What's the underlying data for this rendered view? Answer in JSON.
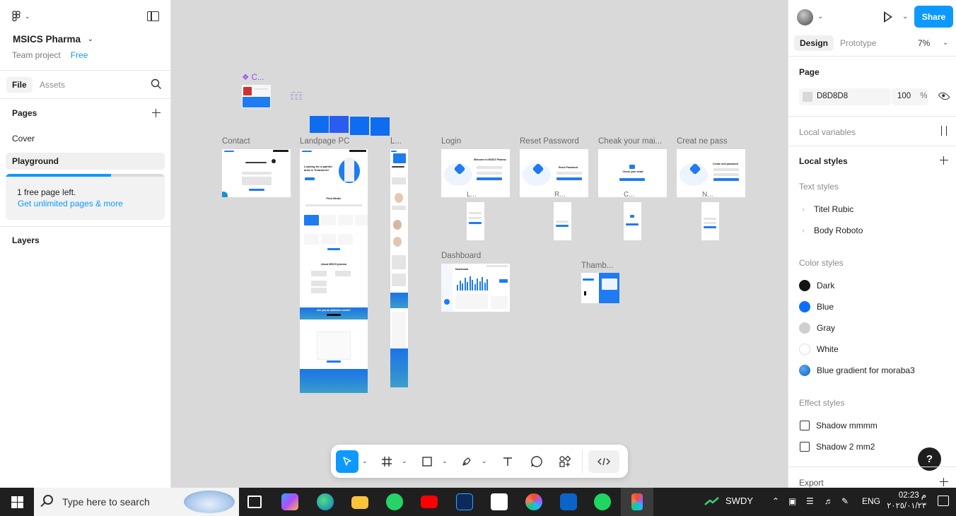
{
  "left_panel": {
    "project_name": "MSICS Pharma",
    "team_label": "Team project",
    "plan_label": "Free",
    "tabs": [
      "File",
      "Assets"
    ],
    "pages_title": "Pages",
    "pages": [
      "Cover",
      "Playground"
    ],
    "selected_page": "Playground",
    "free_pages_text": "1 free page left.",
    "upgrade_link": "Get unlimited pages & more",
    "free_pages_progress": 0.66,
    "layers_title": "Layers"
  },
  "right_panel": {
    "share_label": "Share",
    "tabs": [
      "Design",
      "Prototype"
    ],
    "zoom": "7%",
    "page_section": "Page",
    "page_color": "D8D8D8",
    "page_opacity": "100",
    "page_opacity_unit": "%",
    "local_variables": "Local variables",
    "local_styles": "Local styles",
    "text_styles_title": "Text styles",
    "text_styles": [
      "Titel Rubic",
      "Body Roboto"
    ],
    "color_styles_title": "Color styles",
    "color_styles": [
      {
        "name": "Dark",
        "color": "#141414"
      },
      {
        "name": "Blue",
        "color": "#0d6efd"
      },
      {
        "name": "Gray",
        "color": "#cfcfcf"
      },
      {
        "name": "White",
        "color": "#ffffff"
      },
      {
        "name": "Blue gradient for moraba3",
        "color": "#1a78d6"
      }
    ],
    "effect_styles_title": "Effect styles",
    "effect_styles": [
      "Shadow mmmm",
      "Shadow 2 mm2"
    ],
    "export_label": "Export",
    "help_label": "?"
  },
  "canvas": {
    "component_label": "C...",
    "frames": {
      "contact": "Contact",
      "landpage": "Landpage PC",
      "mobile": "L...",
      "login": "Login",
      "reset": "Reset Password",
      "check": "Cheak your mai...",
      "create": "Creat ne pass",
      "login_m": "L...",
      "reset_m": "R...",
      "check_m": "C...",
      "create_m": "N...",
      "dashboard": "Dashboard",
      "thumb": "Thamb..."
    },
    "landing_headline": "Looking for a painful area in Treatment?",
    "landing_section": "Find Medic",
    "login_title": "Welcome to MSICS Pharma",
    "reset_title": "Reset Password",
    "check_title": "Check your email",
    "create_title": "Create new password",
    "dashboard_title": "Dashboard",
    "about_title": "About MSICS pharma",
    "cta_title": "Are you an addiction medic?"
  },
  "toolbar": {
    "tools": [
      "move",
      "frame",
      "rectangle",
      "pen",
      "text",
      "comment",
      "components",
      "dev-mode"
    ]
  },
  "taskbar": {
    "search_placeholder": "Type here to search",
    "ticker": "SWDY",
    "lang": "ENG",
    "time": "م 02:23",
    "date": "٢٠٢٥/٠١/٢٣"
  }
}
